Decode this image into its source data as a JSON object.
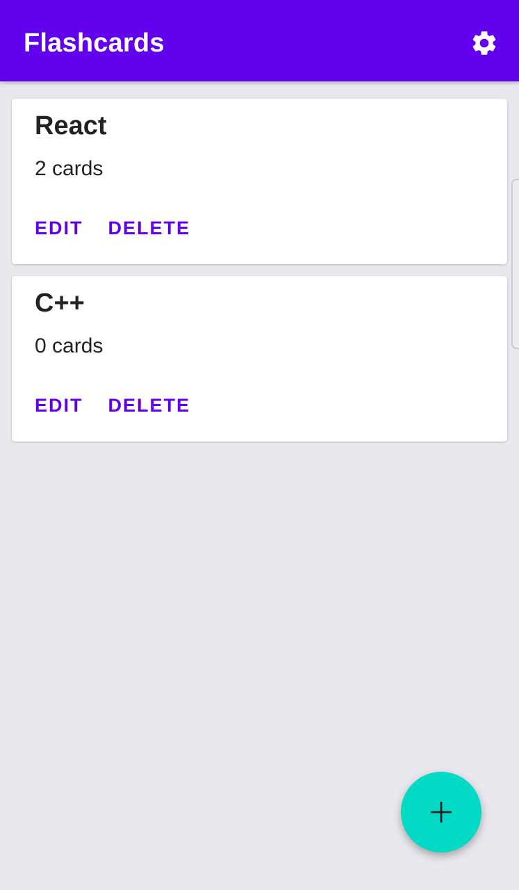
{
  "app": {
    "title": "Flashcards",
    "accent_color": "#6200ee",
    "fab_color": "#03dac5"
  },
  "toolbar": {
    "settings_icon": "gear-icon"
  },
  "decks": [
    {
      "name": "React",
      "count": "2 cards",
      "edit_label": "EDIT",
      "delete_label": "DELETE"
    },
    {
      "name": "C++",
      "count": "0 cards",
      "edit_label": "EDIT",
      "delete_label": "DELETE"
    }
  ],
  "fab": {
    "icon": "plus-icon"
  }
}
